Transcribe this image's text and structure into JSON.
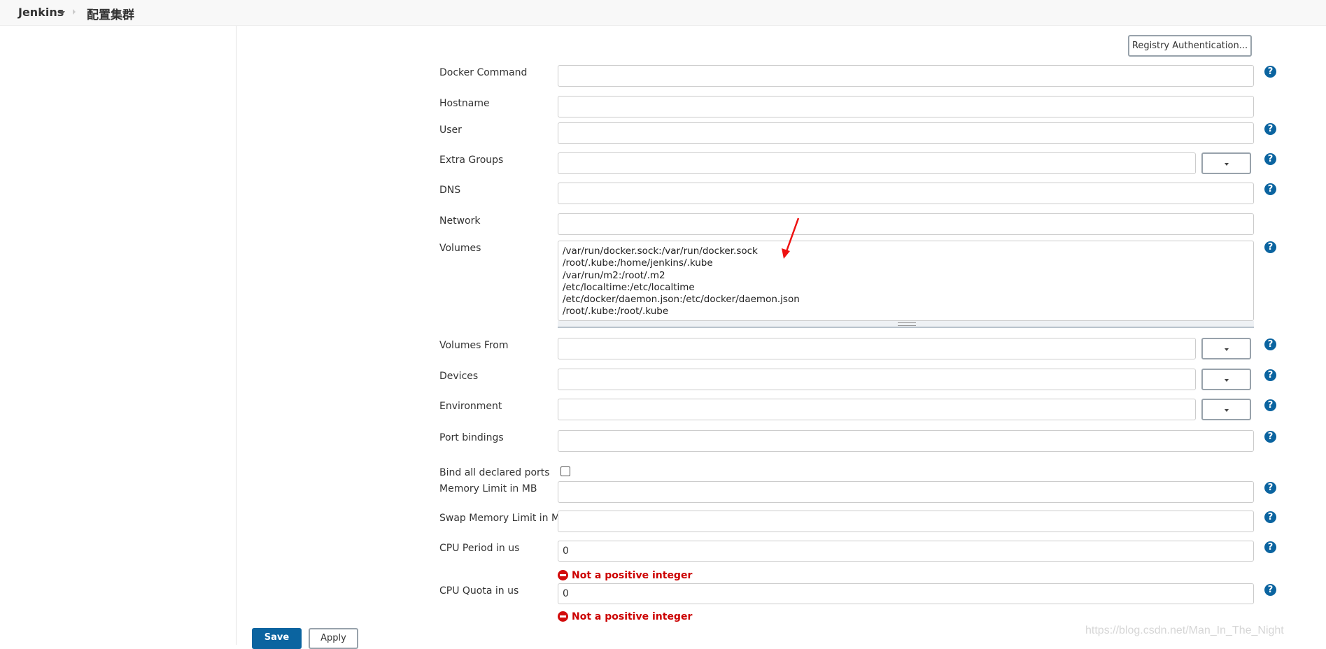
{
  "breadcrumb": {
    "root": "Jenkins",
    "current": "配置集群"
  },
  "registry_button": "Registry Authentication...",
  "fields": [
    {
      "label": "Docker Command",
      "type": "text",
      "value": "",
      "help": true
    },
    {
      "label": "Hostname",
      "type": "text",
      "value": "",
      "help": false
    },
    {
      "label": "User",
      "type": "text",
      "value": "",
      "help": true
    },
    {
      "label": "Extra Groups",
      "type": "combo",
      "value": "",
      "help": true
    },
    {
      "label": "DNS",
      "type": "text",
      "value": "",
      "help": true
    },
    {
      "label": "Network",
      "type": "text",
      "value": "",
      "help": false
    },
    {
      "label": "Volumes",
      "type": "textarea",
      "value": "/var/run/docker.sock:/var/run/docker.sock\n/root/.kube:/home/jenkins/.kube\n/var/run/m2:/root/.m2\n/etc/localtime:/etc/localtime\n/etc/docker/daemon.json:/etc/docker/daemon.json\n/root/.kube:/root/.kube",
      "help": true
    },
    {
      "label": "Volumes From",
      "type": "combo",
      "value": "",
      "help": true
    },
    {
      "label": "Devices",
      "type": "combo",
      "value": "",
      "help": true
    },
    {
      "label": "Environment",
      "type": "combo",
      "value": "",
      "help": true
    },
    {
      "label": "Port bindings",
      "type": "text",
      "value": "",
      "help": true
    },
    {
      "label": "Bind all declared ports",
      "type": "checkbox",
      "checked": false,
      "help": false
    },
    {
      "label": "Memory Limit in MB",
      "type": "text",
      "value": "",
      "help": true
    },
    {
      "label": "Swap Memory Limit in MB",
      "type": "text",
      "value": "",
      "help": true
    },
    {
      "label": "CPU Period in us",
      "type": "text",
      "value": "0",
      "help": true,
      "error": "Not a positive integer"
    },
    {
      "label": "CPU Quota in us",
      "type": "text",
      "value": "0",
      "help": true,
      "error": "Not a positive integer"
    }
  ],
  "buttons": {
    "save": "Save",
    "apply": "Apply"
  },
  "watermark": "https://blog.csdn.net/Man_In_The_Night",
  "colors": {
    "primary": "#0b64a0",
    "error": "#cc0000",
    "annotation_arrow": "#ee1111"
  }
}
